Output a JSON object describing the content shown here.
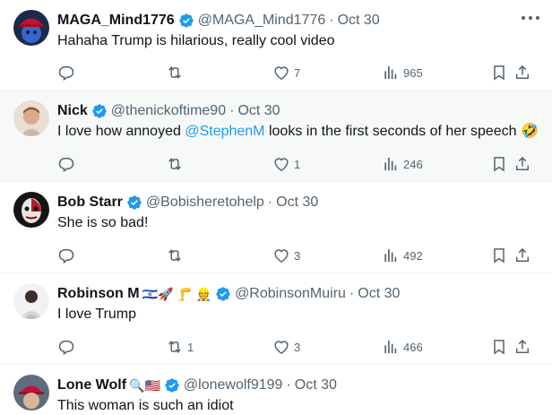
{
  "colors": {
    "accent": "#1d9bf0",
    "muted": "#536471",
    "text": "#0f1419",
    "divider": "#eff3f4",
    "hover_bg": "#f7f9f9"
  },
  "tweets": [
    {
      "display_name": "MAGA_Mind1776",
      "name_emoji": "",
      "verified": true,
      "handle": "@MAGA_Mind1776",
      "separator": "·",
      "date": "Oct 30",
      "text": "Hahaha Trump is hilarious, really cool video",
      "mention": "",
      "text_after": "",
      "avatar": "red-cap-avatar",
      "counts": {
        "reply": "",
        "retweet": "",
        "like": "7",
        "views": "965"
      }
    },
    {
      "display_name": "Nick",
      "name_emoji": "",
      "verified": true,
      "handle": "@thenickoftime90",
      "separator": "·",
      "date": "Oct 30",
      "text": "I love how annoyed ",
      "mention": "@StephenM",
      "text_after": " looks in the first seconds of her speech 🤣",
      "avatar": "beige-avatar",
      "counts": {
        "reply": "",
        "retweet": "",
        "like": "1",
        "views": "246"
      }
    },
    {
      "display_name": "Bob Starr",
      "name_emoji": "",
      "verified": true,
      "handle": "@Bobisheretohelp",
      "separator": "·",
      "date": "Oct 30",
      "text": "She is so bad!",
      "mention": "",
      "text_after": "",
      "avatar": "face-paint-avatar",
      "counts": {
        "reply": "",
        "retweet": "",
        "like": "3",
        "views": "492"
      }
    },
    {
      "display_name": "Robinson M",
      "name_emoji": "🇮🇱🚀 🦵 👷",
      "verified": true,
      "handle": "@RobinsonMuiru",
      "separator": "·",
      "date": "Oct 30",
      "text": "I love Trump",
      "mention": "",
      "text_after": "",
      "avatar": "person-avatar",
      "counts": {
        "reply": "",
        "retweet": "1",
        "like": "3",
        "views": "466"
      }
    },
    {
      "display_name": "Lone Wolf",
      "name_emoji": "🔍🇺🇸",
      "verified": true,
      "handle": "@lonewolf9199",
      "separator": "·",
      "date": "Oct 30",
      "text": "This woman is such an idiot",
      "mention": "",
      "text_after": "",
      "avatar": "red-hat-avatar",
      "counts": {
        "reply": "",
        "retweet": "",
        "like": "",
        "views": ""
      }
    }
  ]
}
